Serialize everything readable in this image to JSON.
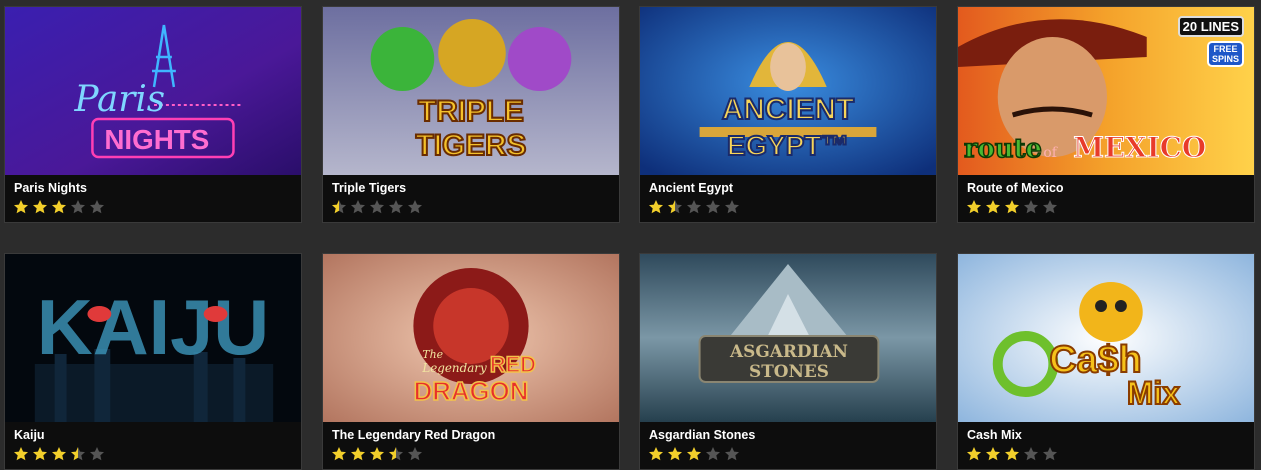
{
  "games": [
    {
      "title": "Paris Nights",
      "rating": 3,
      "art": {
        "line1": "Paris",
        "line2": "NIGHTS"
      }
    },
    {
      "title": "Triple Tigers",
      "rating": 0.5,
      "art": {
        "line1": "TRIPLE",
        "line2": "TIGERS"
      }
    },
    {
      "title": "Ancient Egypt",
      "rating": 1.5,
      "art": {
        "line1": "ANCIENT",
        "line2": "EGYPT™"
      }
    },
    {
      "title": "Route of Mexico",
      "rating": 3,
      "art": {
        "line1": "route",
        "line2": "of",
        "line3": "MEXICO",
        "badge": "20 LINES",
        "free": "FREE",
        "spins": "SPINS"
      }
    },
    {
      "title": "Kaiju",
      "rating": 3.5,
      "art": {
        "line1": "KAIJU"
      }
    },
    {
      "title": "The Legendary Red Dragon",
      "rating": 3.5,
      "art": {
        "line1": "The",
        "line2": "Legendary",
        "line3": "RED",
        "line4": "DRAGON"
      }
    },
    {
      "title": "Asgardian Stones",
      "rating": 3,
      "art": {
        "line1": "ASGARDIAN",
        "line2": "STONES"
      }
    },
    {
      "title": "Cash Mix",
      "rating": 3,
      "art": {
        "line1": "Ca$h",
        "line2": "Mix"
      }
    }
  ],
  "colors": {
    "star_on": "#f2cf2b",
    "star_off": "#555555",
    "card_bg": "#0d0d0d",
    "page_bg": "#2c2c2c"
  },
  "icons": {
    "rating": "star-icon"
  }
}
